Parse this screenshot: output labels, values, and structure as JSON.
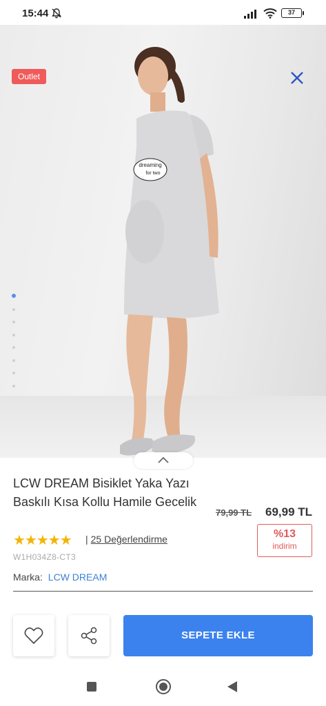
{
  "status_bar": {
    "time": "15:44",
    "battery": "37",
    "icons": [
      "bell-off-icon",
      "signal-icon",
      "wifi-icon",
      "battery-icon"
    ]
  },
  "image": {
    "badge": "Outlet",
    "print_text_line1": "dreaming",
    "print_text_line2": "for two",
    "carousel_total": 8,
    "carousel_active": 1
  },
  "product": {
    "title": "LCW DREAM Bisiklet Yaka Yazı Baskılı Kısa Kollu Hamile Gecelik",
    "old_price": "79,99 TL",
    "new_price": "69,99 TL",
    "discount_pct": "%13",
    "discount_label": "indirim",
    "rating_stars": "★★★★★",
    "rating_value": 5,
    "review_sep": "|",
    "reviews": "25 Değerlendirme",
    "sku": "W1H034Z8-CT3",
    "brand_label": "Marka:",
    "brand_value": "LCW DREAM"
  },
  "actions": {
    "add_to_cart": "SEPETE EKLE"
  },
  "colors": {
    "accent": "#3b82ee",
    "badge": "#ef5a5a",
    "discount": "#e05a5a",
    "star": "#f4b400",
    "brand_link": "#3b82d6"
  }
}
